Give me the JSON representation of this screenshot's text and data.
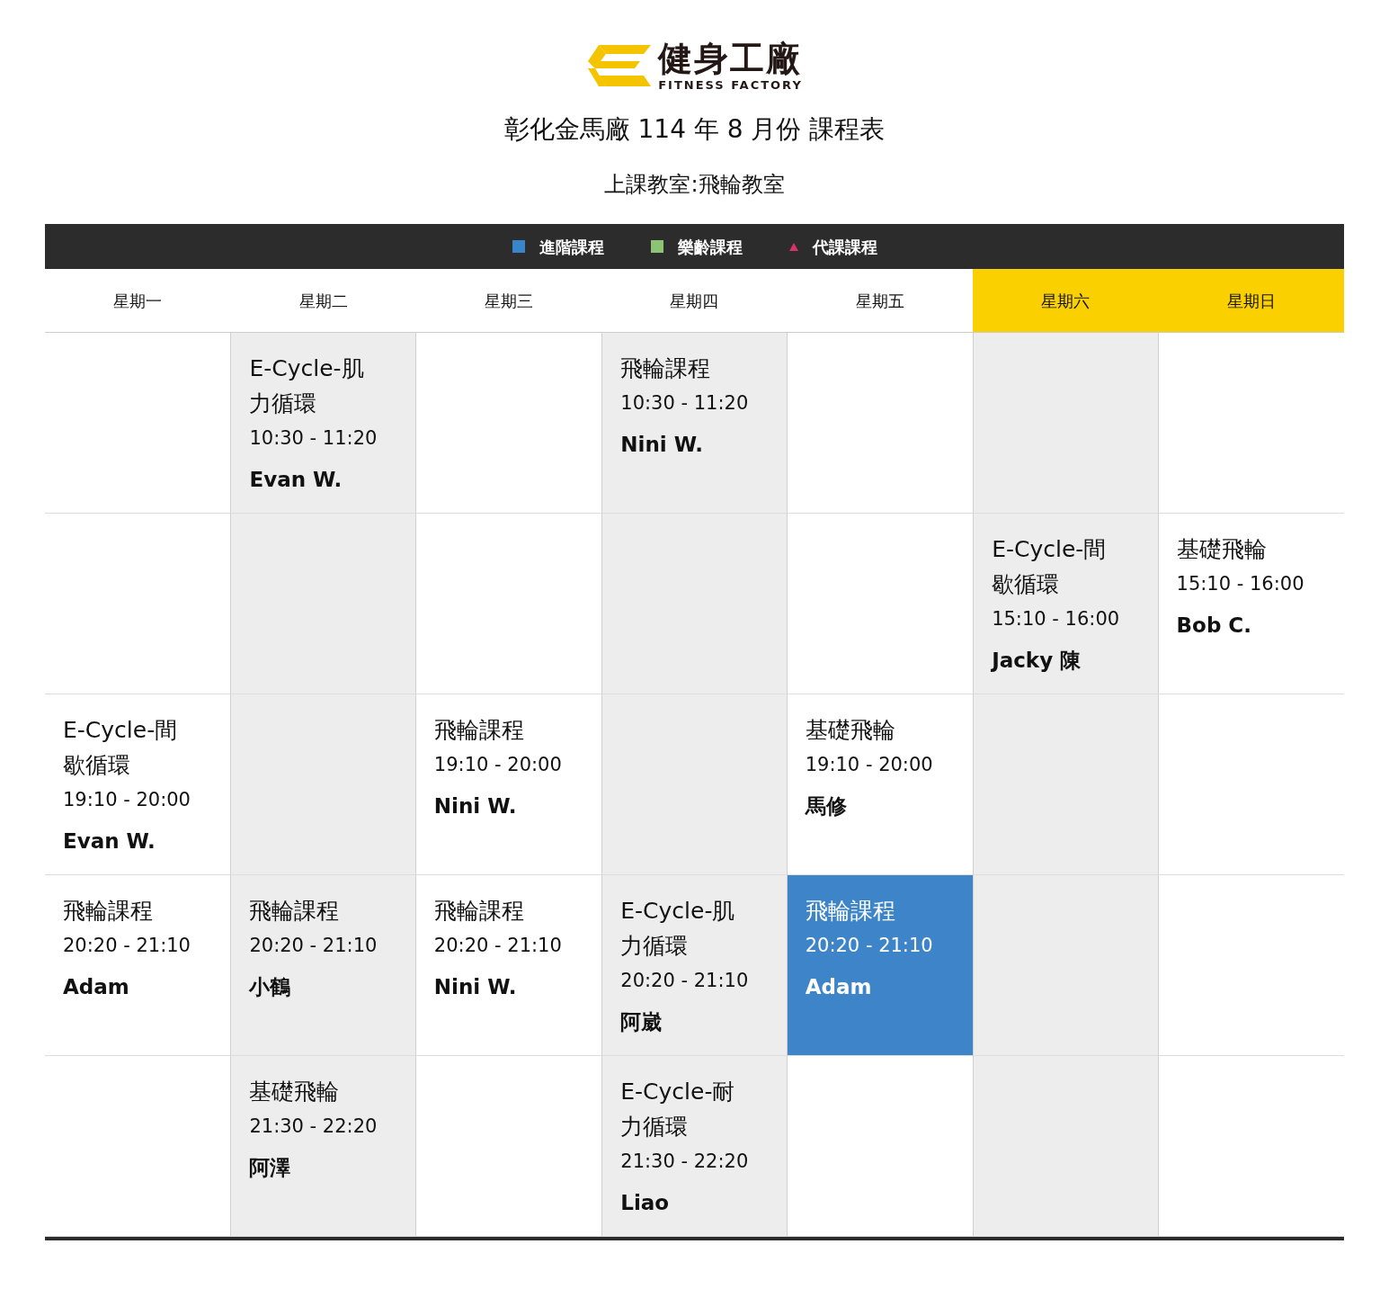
{
  "logo": {
    "name": "健身工廠",
    "tagline": "FITNESS FACTORY"
  },
  "title": "彰化金馬廠 114 年 8 月份 課程表",
  "room": "上課教室:飛輪教室",
  "legend": [
    {
      "kind": "square",
      "color": "#3a84c9",
      "label": "進階課程"
    },
    {
      "kind": "square",
      "color": "#8cc474",
      "label": "樂齡課程"
    },
    {
      "kind": "triangle",
      "color": "#d6336c",
      "label": "代課課程"
    }
  ],
  "days": [
    {
      "label": "星期一",
      "weekend": false
    },
    {
      "label": "星期二",
      "weekend": false
    },
    {
      "label": "星期三",
      "weekend": false
    },
    {
      "label": "星期四",
      "weekend": false
    },
    {
      "label": "星期五",
      "weekend": false
    },
    {
      "label": "星期六",
      "weekend": true
    },
    {
      "label": "星期日",
      "weekend": true
    }
  ],
  "rows": [
    [
      null,
      {
        "name": "E-Cycle-肌力循環",
        "time": "10:30 - 11:20",
        "coach": "Evan W.",
        "highlighted": false
      },
      null,
      {
        "name": "飛輪課程",
        "time": "10:30 - 11:20",
        "coach": "Nini W.",
        "highlighted": false
      },
      null,
      null,
      null
    ],
    [
      null,
      null,
      null,
      null,
      null,
      {
        "name": "E-Cycle-間歇循環",
        "time": "15:10 - 16:00",
        "coach": "Jacky 陳",
        "highlighted": false
      },
      {
        "name": "基礎飛輪",
        "time": "15:10 - 16:00",
        "coach": "Bob C.",
        "highlighted": false
      }
    ],
    [
      {
        "name": "E-Cycle-間歇循環",
        "time": "19:10 - 20:00",
        "coach": "Evan W.",
        "highlighted": false
      },
      null,
      {
        "name": "飛輪課程",
        "time": "19:10 - 20:00",
        "coach": "Nini W.",
        "highlighted": false
      },
      null,
      {
        "name": "基礎飛輪",
        "time": "19:10 - 20:00",
        "coach": "馬修",
        "highlighted": false
      },
      null,
      null
    ],
    [
      {
        "name": "飛輪課程",
        "time": "20:20 - 21:10",
        "coach": "Adam",
        "highlighted": false
      },
      {
        "name": "飛輪課程",
        "time": "20:20 - 21:10",
        "coach": "小鶴",
        "highlighted": false
      },
      {
        "name": "飛輪課程",
        "time": "20:20 - 21:10",
        "coach": "Nini W.",
        "highlighted": false
      },
      {
        "name": "E-Cycle-肌力循環",
        "time": "20:20 - 21:10",
        "coach": "阿崴",
        "highlighted": false
      },
      {
        "name": "飛輪課程",
        "time": "20:20 - 21:10",
        "coach": "Adam",
        "highlighted": true
      },
      null,
      null
    ],
    [
      null,
      {
        "name": "基礎飛輪",
        "time": "21:30 - 22:20",
        "coach": "阿澤",
        "highlighted": false
      },
      null,
      {
        "name": "E-Cycle-耐力循環",
        "time": "21:30 - 22:20",
        "coach": "Liao",
        "highlighted": false
      },
      null,
      null,
      null
    ]
  ]
}
